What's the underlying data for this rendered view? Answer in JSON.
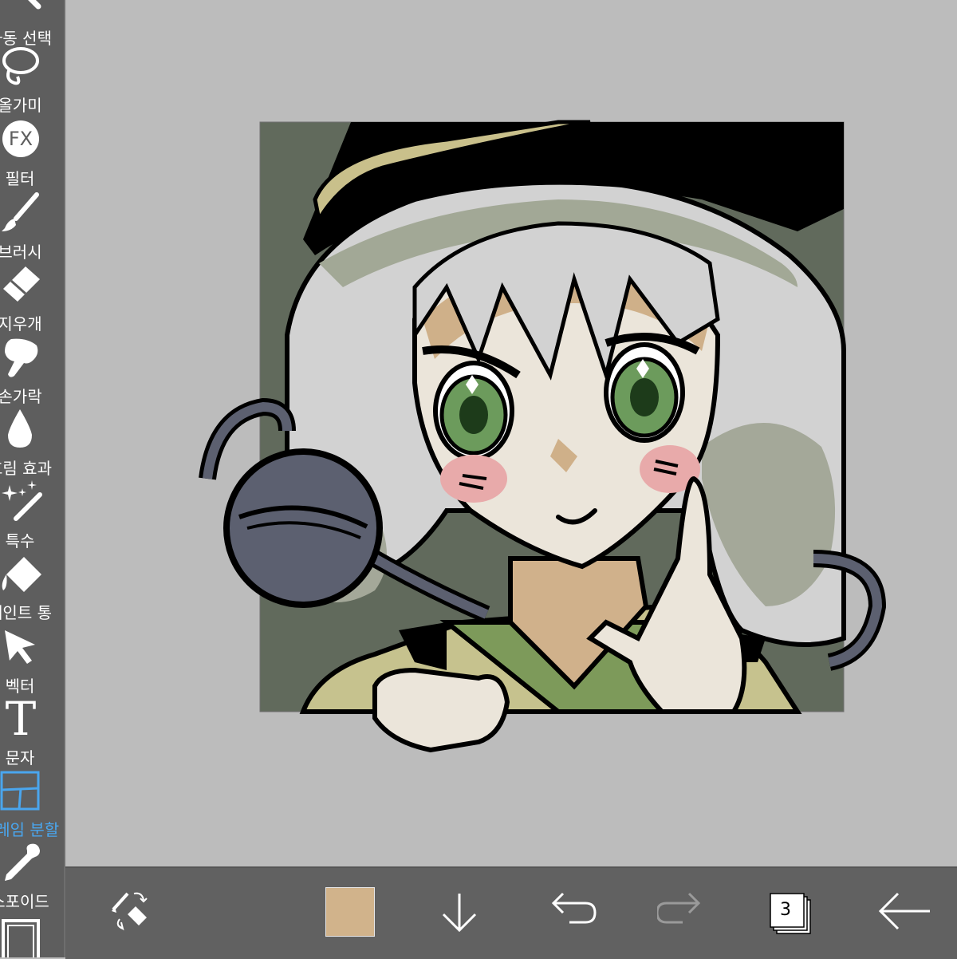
{
  "sidebar": {
    "items": [
      {
        "id": "auto-select",
        "label": "자동 선택"
      },
      {
        "id": "lasso",
        "label": "올가미"
      },
      {
        "id": "filter",
        "label": "필터",
        "icon_text": "FX"
      },
      {
        "id": "brush",
        "label": "브러시"
      },
      {
        "id": "eraser",
        "label": "지우개"
      },
      {
        "id": "smudge",
        "label": "손가락"
      },
      {
        "id": "blur",
        "label": "흐림 효과"
      },
      {
        "id": "special",
        "label": "특수"
      },
      {
        "id": "paint-bucket",
        "label": "페인트 통"
      },
      {
        "id": "vector",
        "label": "벡터"
      },
      {
        "id": "text",
        "label": "문자",
        "icon_text": "T"
      },
      {
        "id": "frame-divide",
        "label": "프레임 분할",
        "active": true
      },
      {
        "id": "eyedropper",
        "label": "스포이드"
      }
    ],
    "active_color": "#4aa6ee"
  },
  "toolbar": {
    "current_color": "#d1b38b",
    "layer_count": "3",
    "redo_enabled": false
  },
  "canvas": {
    "background": "#bcbcbc",
    "artwork_bg": "#616a5c"
  }
}
